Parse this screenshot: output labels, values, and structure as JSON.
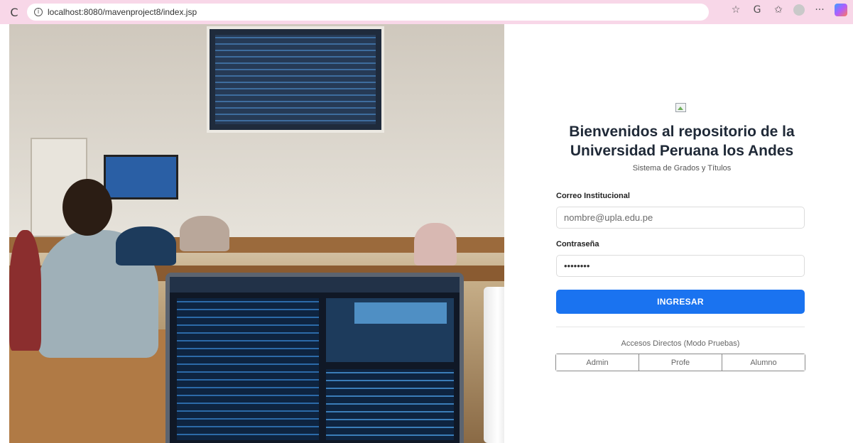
{
  "browser": {
    "url": "localhost:8080/mavenproject8/index.jsp",
    "reload_icon": "reload-icon",
    "info_icon": "info-icon",
    "icons": [
      "star-icon",
      "refresh-circle-icon",
      "favorites-icon",
      "profile-icon",
      "more-icon",
      "copilot-icon"
    ],
    "more_glyph": "···"
  },
  "login": {
    "title_line1": "Bienvenidos al repositorio de la",
    "title_line2": "Universidad Peruana los Andes",
    "subtitle": "Sistema de Grados y Títulos",
    "email_label": "Correo Institucional",
    "email_placeholder": "nombre@upla.edu.pe",
    "password_label": "Contraseña",
    "password_value": "12345678",
    "submit_label": "INGRESAR",
    "quick_access_title": "Accesos Directos (Modo Pruebas)",
    "quick_access": [
      {
        "label": "Admin"
      },
      {
        "label": "Profe"
      },
      {
        "label": "Alumno"
      }
    ]
  },
  "colors": {
    "chrome_bg": "#f8d7e8",
    "primary": "#1a73f0"
  }
}
